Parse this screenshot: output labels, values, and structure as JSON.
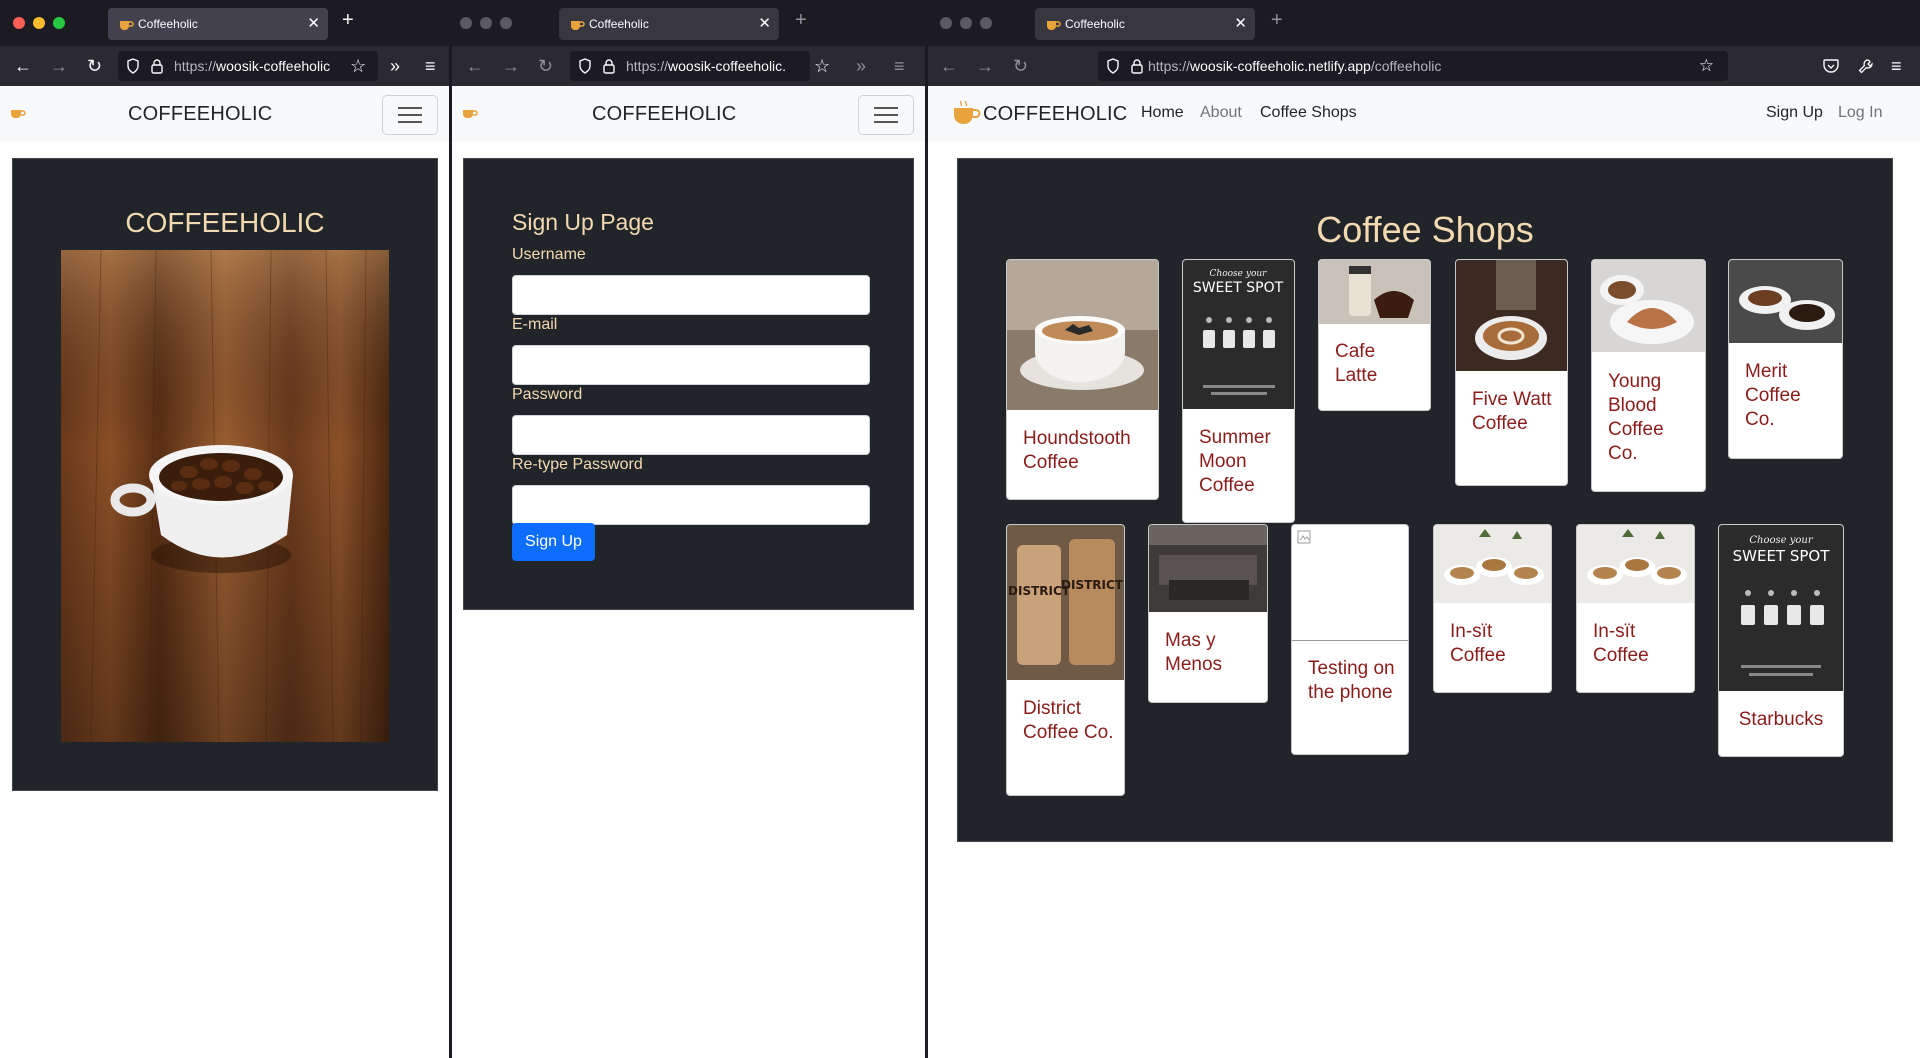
{
  "tab_title": "Coffeeholic",
  "brand": "COFFEEHOLIC",
  "window1": {
    "url_prefix": "https://",
    "url_domain": "woosik-coffeeholic",
    "hero_title": "COFFEEHOLIC"
  },
  "window2": {
    "url_prefix": "https://",
    "url_domain": "woosik-coffeeholic.",
    "form_title": "Sign Up Page",
    "fields": [
      {
        "label": "Username",
        "value": ""
      },
      {
        "label": "E-mail",
        "value": ""
      },
      {
        "label": "Password",
        "value": ""
      },
      {
        "label": "Re-type Password",
        "value": ""
      }
    ],
    "submit_label": "Sign Up"
  },
  "window3": {
    "url_prefix": "https://",
    "url_domain": "woosik-coffeeholic.netlify.app",
    "url_path": "/coffeeholic",
    "nav": {
      "home": "Home",
      "about": "About",
      "coffee_shops": "Coffee Shops",
      "signup": "Sign Up",
      "login": "Log In"
    },
    "section_title": "Coffee Shops",
    "shops": [
      "Houndstooth Coffee",
      "Summer Moon Coffee",
      "Cafe Latte",
      "Five Watt Coffee",
      "Young Blood Coffee Co.",
      "Merit Coffee Co.",
      "District Coffee Co.",
      "Mas y Menos",
      "Testing on the phone",
      "In-sït Coffee",
      "In-sït Coffee",
      "Starbucks"
    ],
    "poster_text": {
      "line1": "Choose your",
      "line2": "SWEET SPOT"
    },
    "cup_text": "DISTRICT"
  },
  "colors": {
    "panel": "#212529",
    "accent_text": "#f3d9b1",
    "card_title": "#8b1c1c",
    "button": "#0d6efd",
    "navbar": "#f8f9fa",
    "chrome_dark": "#1c1b22",
    "chrome_toolbar": "#2b2a33"
  },
  "icons": {
    "back": "arrow-left-icon",
    "forward": "arrow-right-icon",
    "reload": "reload-icon",
    "shield": "shield-icon",
    "lock": "lock-icon",
    "star": "bookmark-star-icon",
    "overflow": "chevrons-right-icon",
    "menu": "hamburger-menu-icon",
    "pocket": "pocket-icon",
    "wrench": "wrench-icon",
    "favicon": "coffee-cup-icon"
  }
}
